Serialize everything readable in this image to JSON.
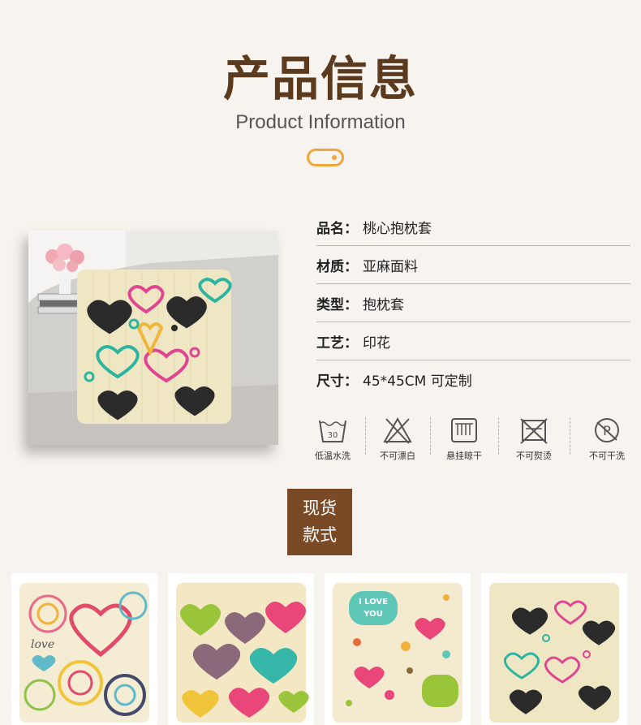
{
  "header": {
    "title_zh": "产品信息",
    "title_en": "Product Information"
  },
  "product_info": [
    {
      "key": "品名：",
      "value": "桃心抱枕套"
    },
    {
      "key": "材质：",
      "value": "亚麻面料"
    },
    {
      "key": "类型：",
      "value": "抱枕套"
    },
    {
      "key": "工艺：",
      "value": "印花"
    },
    {
      "key": "尺寸：",
      "value": "45*45CM  可定制"
    }
  ],
  "care_icons": [
    {
      "icon": "wash-30-icon",
      "label": "低温水洗",
      "number": "30"
    },
    {
      "icon": "no-bleach-icon",
      "label": "不可漂白"
    },
    {
      "icon": "hang-dry-icon",
      "label": "悬挂晾干"
    },
    {
      "icon": "no-iron-icon",
      "label": "不可熨烫"
    },
    {
      "icon": "no-dry-clean-icon",
      "label": "不可干洗",
      "letter": "P"
    }
  ],
  "stock_badge": {
    "line1": "现货",
    "line2": "款式"
  },
  "thumb_texts": {
    "love_text": "love",
    "i_love_you": "I LOVE",
    "you": "YOU"
  },
  "colors": {
    "brown_title": "#5c3a1e",
    "accent_orange": "#f0a63a",
    "badge_brown": "#7a4a26",
    "background": "#f7f3ee"
  }
}
